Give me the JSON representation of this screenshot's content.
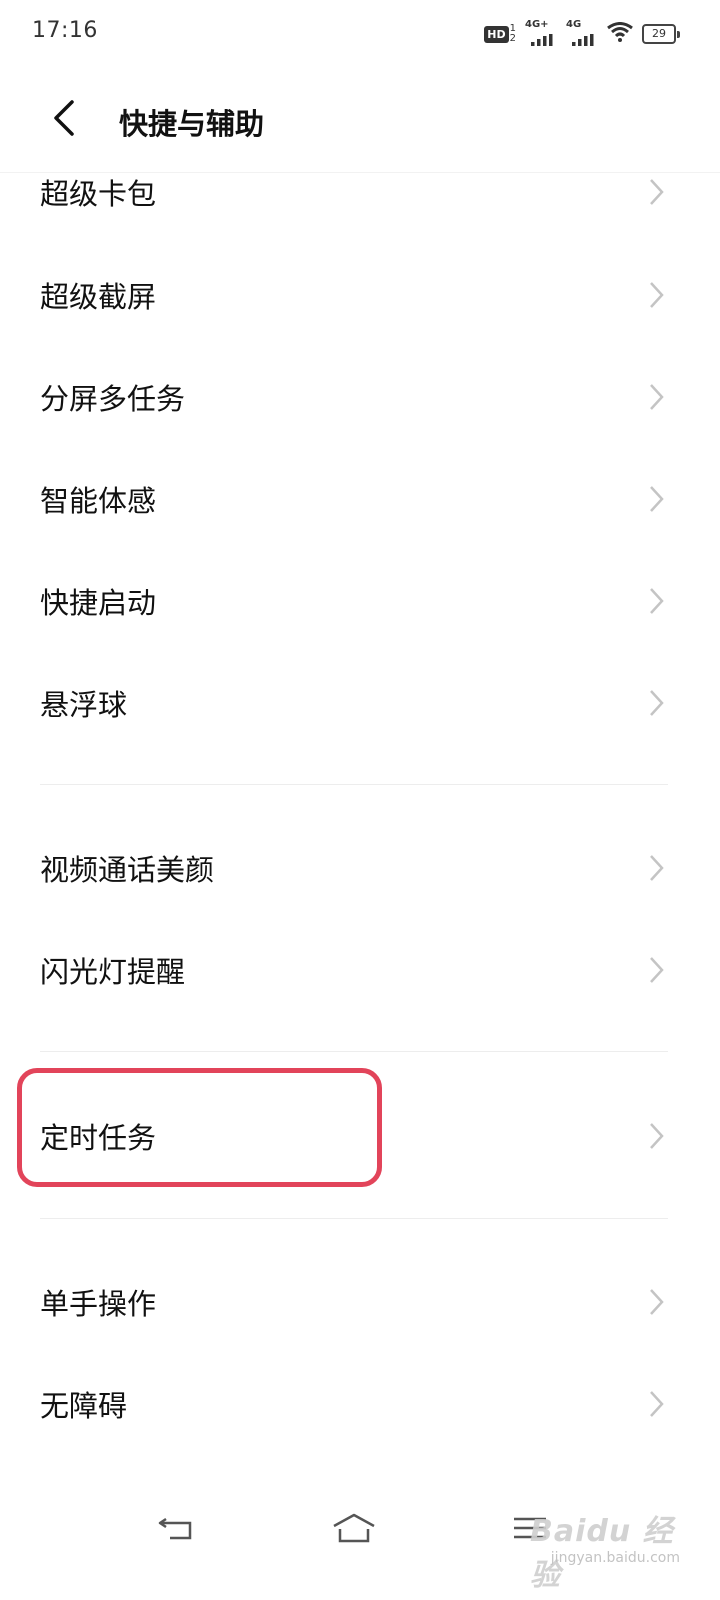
{
  "status_bar": {
    "time": "17:16",
    "hd_label": "HD",
    "hd_sim_top": "1",
    "hd_sim_bottom": "2",
    "signal1_label": "4G+",
    "signal2_label": "4G",
    "battery_level": "29"
  },
  "header": {
    "title": "快捷与辅助"
  },
  "menu": {
    "items": [
      {
        "label": "超级卡包"
      },
      {
        "label": "超级截屏"
      },
      {
        "label": "分屏多任务"
      },
      {
        "label": "智能体感"
      },
      {
        "label": "快捷启动"
      },
      {
        "label": "悬浮球"
      },
      {
        "label": "视频通话美颜"
      },
      {
        "label": "闪光灯提醒"
      },
      {
        "label": "定时任务"
      },
      {
        "label": "单手操作"
      },
      {
        "label": "无障碍"
      }
    ]
  },
  "colors": {
    "highlight": "#e2445a",
    "chevron": "#c4c4c4"
  },
  "watermark": {
    "main": "Baidu 经验",
    "url": "jingyan.baidu.com"
  }
}
